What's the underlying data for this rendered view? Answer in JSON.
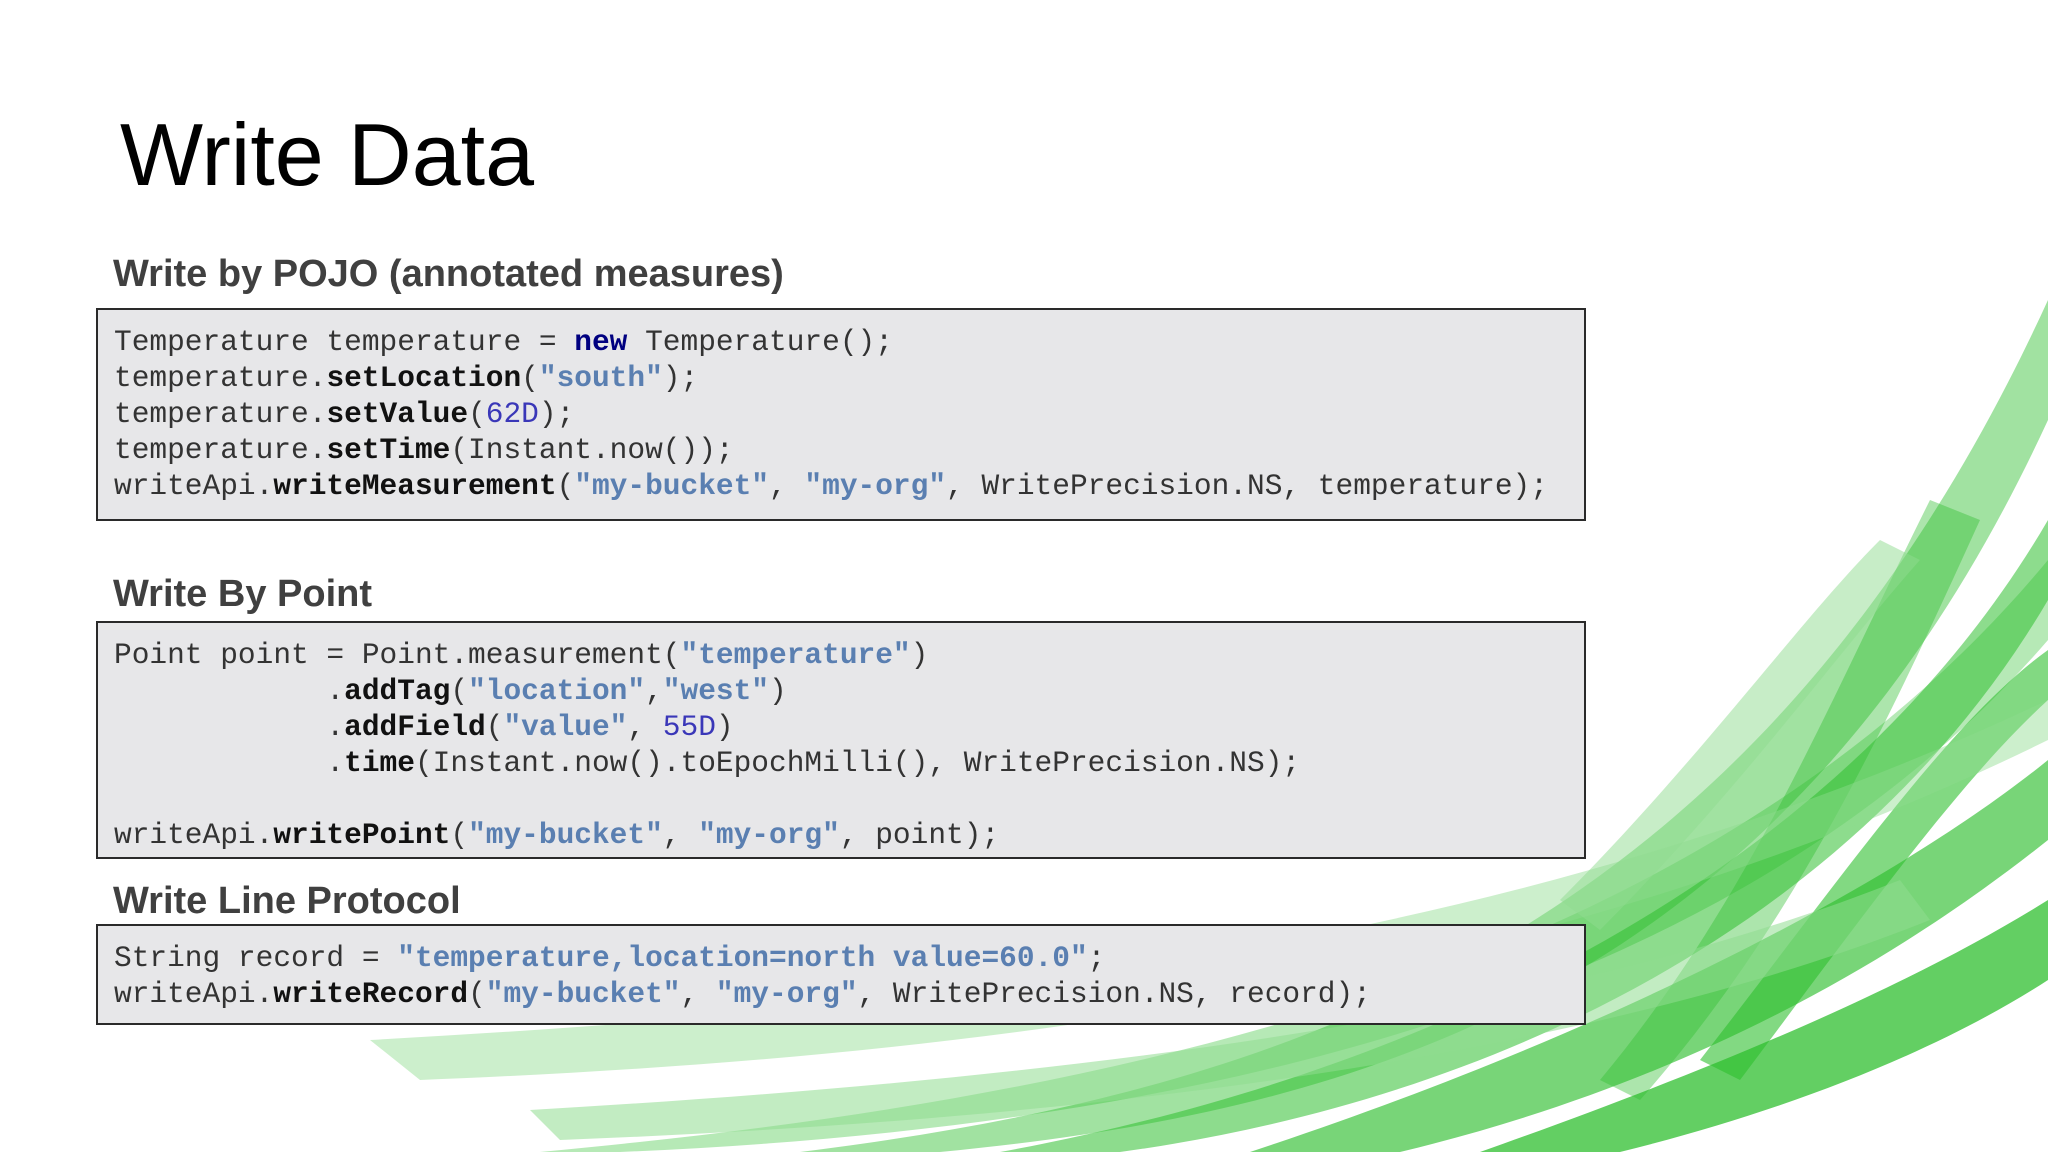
{
  "slide": {
    "title": "Write Data",
    "colors": {
      "background": "#ffffff",
      "code_background": "#e7e7e9",
      "keyword": "#000080",
      "string": "#5a7fb1",
      "number": "#3a37b8",
      "accent": "#2eb82e"
    }
  },
  "sections": [
    {
      "heading": "Write by POJO (annotated measures)",
      "lines": [
        [
          {
            "t": "Temperature temperature = ",
            "c": "p"
          },
          {
            "t": "new",
            "c": "kw"
          },
          {
            "t": " Temperature();",
            "c": "p"
          }
        ],
        [
          {
            "t": "temperature.",
            "c": "p"
          },
          {
            "t": "setLocation",
            "c": "b"
          },
          {
            "t": "(",
            "c": "p"
          },
          {
            "t": "\"south\"",
            "c": "s"
          },
          {
            "t": ");",
            "c": "p"
          }
        ],
        [
          {
            "t": "temperature.",
            "c": "p"
          },
          {
            "t": "setValue",
            "c": "b"
          },
          {
            "t": "(",
            "c": "p"
          },
          {
            "t": "62D",
            "c": "n"
          },
          {
            "t": ");",
            "c": "p"
          }
        ],
        [
          {
            "t": "temperature.",
            "c": "p"
          },
          {
            "t": "setTime",
            "c": "b"
          },
          {
            "t": "(Instant.now());",
            "c": "p"
          }
        ],
        [
          {
            "t": "writeApi.",
            "c": "p"
          },
          {
            "t": "writeMeasurement",
            "c": "b"
          },
          {
            "t": "(",
            "c": "p"
          },
          {
            "t": "\"my-bucket\"",
            "c": "s"
          },
          {
            "t": ", ",
            "c": "p"
          },
          {
            "t": "\"my-org\"",
            "c": "s"
          },
          {
            "t": ", WritePrecision.NS, temperature);",
            "c": "p"
          }
        ]
      ]
    },
    {
      "heading": "Write By Point",
      "lines": [
        [
          {
            "t": "Point point = Point.measurement(",
            "c": "p"
          },
          {
            "t": "\"temperature\"",
            "c": "s"
          },
          {
            "t": ")",
            "c": "p"
          }
        ],
        [
          {
            "t": "            .",
            "c": "p"
          },
          {
            "t": "addTag",
            "c": "b"
          },
          {
            "t": "(",
            "c": "p"
          },
          {
            "t": "\"location\"",
            "c": "s"
          },
          {
            "t": ",",
            "c": "p"
          },
          {
            "t": "\"west\"",
            "c": "s"
          },
          {
            "t": ")",
            "c": "p"
          }
        ],
        [
          {
            "t": "            .",
            "c": "p"
          },
          {
            "t": "addField",
            "c": "b"
          },
          {
            "t": "(",
            "c": "p"
          },
          {
            "t": "\"value\"",
            "c": "s"
          },
          {
            "t": ", ",
            "c": "p"
          },
          {
            "t": "55D",
            "c": "n"
          },
          {
            "t": ")",
            "c": "p"
          }
        ],
        [
          {
            "t": "            .",
            "c": "p"
          },
          {
            "t": "time",
            "c": "b"
          },
          {
            "t": "(Instant.now().toEpochMilli(), WritePrecision.NS);",
            "c": "p"
          }
        ],
        [
          {
            "t": "",
            "c": "p"
          }
        ],
        [
          {
            "t": "writeApi.",
            "c": "p"
          },
          {
            "t": "writePoint",
            "c": "b"
          },
          {
            "t": "(",
            "c": "p"
          },
          {
            "t": "\"my-bucket\"",
            "c": "s"
          },
          {
            "t": ", ",
            "c": "p"
          },
          {
            "t": "\"my-org\"",
            "c": "s"
          },
          {
            "t": ", point);",
            "c": "p"
          }
        ]
      ]
    },
    {
      "heading": "Write Line Protocol",
      "lines": [
        [
          {
            "t": "String record = ",
            "c": "p"
          },
          {
            "t": "\"temperature,location=north value=60.0\"",
            "c": "s"
          },
          {
            "t": ";",
            "c": "p"
          }
        ],
        [
          {
            "t": "writeApi.",
            "c": "p"
          },
          {
            "t": "writeRecord",
            "c": "b"
          },
          {
            "t": "(",
            "c": "p"
          },
          {
            "t": "\"my-bucket\"",
            "c": "s"
          },
          {
            "t": ", ",
            "c": "p"
          },
          {
            "t": "\"my-org\"",
            "c": "s"
          },
          {
            "t": ", WritePrecision.NS, record);",
            "c": "p"
          }
        ]
      ]
    }
  ]
}
